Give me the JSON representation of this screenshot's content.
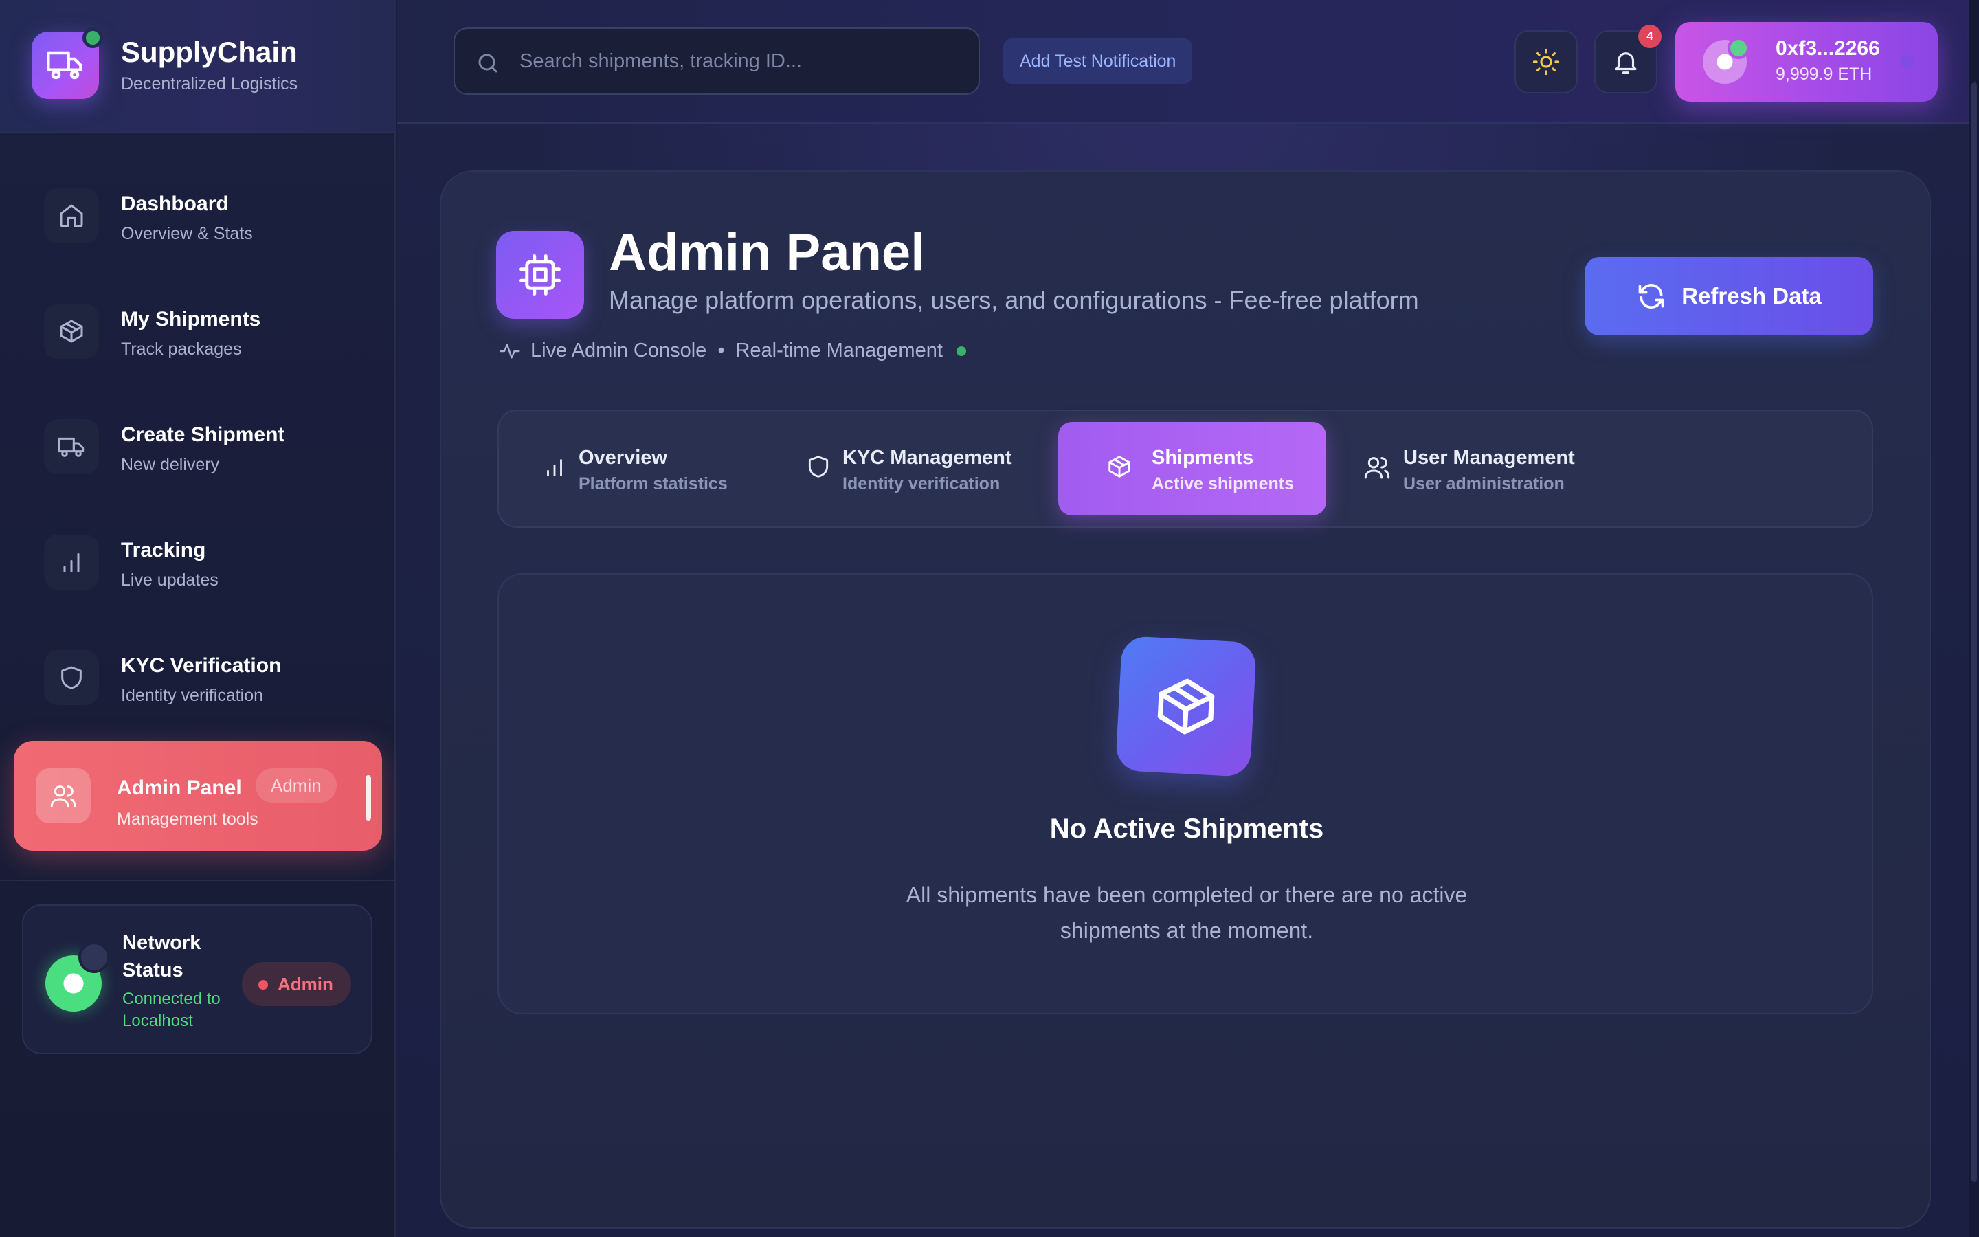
{
  "brand": {
    "title": "SupplyChain",
    "subtitle": "Decentralized Logistics",
    "logo_icon": "truck-icon",
    "accent": "#7c5cf2"
  },
  "sidebar": {
    "items": [
      {
        "title": "Dashboard",
        "subtitle": "Overview & Stats",
        "icon": "home-icon"
      },
      {
        "title": "My Shipments",
        "subtitle": "Track packages",
        "icon": "package-icon"
      },
      {
        "title": "Create Shipment",
        "subtitle": "New delivery",
        "icon": "truck-icon"
      },
      {
        "title": "Tracking",
        "subtitle": "Live updates",
        "icon": "bar-chart-icon"
      },
      {
        "title": "KYC Verification",
        "subtitle": "Identity verification",
        "icon": "shield-icon"
      },
      {
        "title": "Admin Panel",
        "subtitle": "Management tools",
        "icon": "users-icon",
        "badge": "Admin",
        "active": true
      }
    ],
    "network": {
      "title": "Network Status",
      "status": "Connected to Localhost",
      "badge": "Admin",
      "status_color": "#4ade80"
    }
  },
  "topbar": {
    "search_placeholder": "Search shipments, tracking ID...",
    "test_button": "Add Test Notification",
    "theme_icon": "sun-icon",
    "notification_icon": "bell-icon",
    "notification_count": "4",
    "wallet": {
      "address": "0xf3...2266",
      "balance": "9,999.9 ETH"
    }
  },
  "panel": {
    "title": "Admin Panel",
    "subtitle": "Manage platform operations, users, and configurations - Fee-free platform",
    "live_label": "Live Admin Console",
    "separator": "•",
    "realtime_label": "Real-time Management",
    "refresh_button": "Refresh Data",
    "tabs": [
      {
        "title": "Overview",
        "subtitle": "Platform statistics",
        "icon": "bar-chart-icon"
      },
      {
        "title": "KYC Management",
        "subtitle": "Identity verification",
        "icon": "shield-icon"
      },
      {
        "title": "Shipments",
        "subtitle": "Active shipments",
        "icon": "package-icon",
        "active": true
      },
      {
        "title": "User Management",
        "subtitle": "User administration",
        "icon": "users-icon"
      }
    ],
    "empty_state": {
      "title": "No Active Shipments",
      "message": "All shipments have been completed or there are no active shipments at the moment.",
      "icon": "package-icon"
    }
  },
  "colors": {
    "active_nav": "#f06a73",
    "active_tab": "#a15cf0",
    "refresh": "#5a6cf0",
    "wallet": "#c855e6"
  }
}
